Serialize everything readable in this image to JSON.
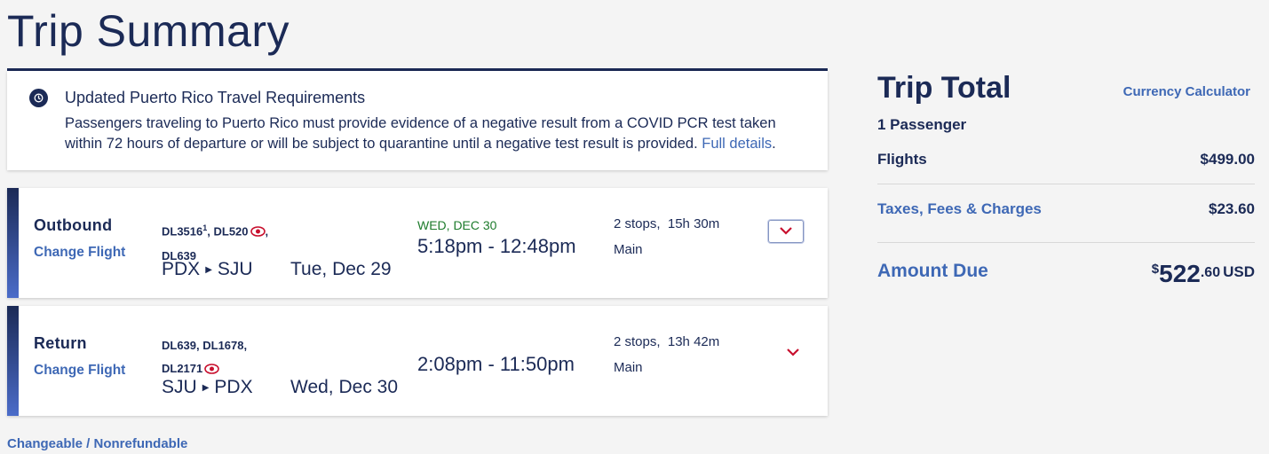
{
  "page": {
    "title": "Trip Summary"
  },
  "alert": {
    "title": "Updated Puerto Rico Travel Requirements",
    "body": "Passengers traveling to Puerto Rico must provide evidence of a negative result from a COVID PCR test taken within 72 hours of departure or will be subject to quarantine until a negative test result is provided.",
    "link_label": "Full details",
    "link_suffix": ".",
    "icon": "info-refresh-icon"
  },
  "flights": [
    {
      "direction": "Outbound",
      "change_label": "Change Flight",
      "flight_numbers_line1": "DL3516",
      "flight_numbers_sup": "1",
      "flight_numbers_line1b": ", DL520",
      "flight_numbers_line1_end": ",",
      "flight_numbers_line2": "DL639",
      "origin": "PDX",
      "destination": "SJU",
      "date": "Tue, Dec 29",
      "arrival_note": "WED, DEC 30",
      "times": "5:18pm - 12:48pm",
      "stops": "2 stops,",
      "duration": "15h 30m",
      "cabin": "Main"
    },
    {
      "direction": "Return",
      "change_label": "Change Flight",
      "flight_numbers_line1": "DL639, DL1678,",
      "flight_numbers_line2": "DL2171",
      "origin": "SJU",
      "destination": "PDX",
      "date": "Wed, Dec 30",
      "arrival_note": "",
      "times": "2:08pm - 11:50pm",
      "stops": "2 stops,",
      "duration": "13h 42m",
      "cabin": "Main"
    }
  ],
  "fare_note": "Changeable / Nonrefundable",
  "summary": {
    "title": "Trip Total",
    "currency_link": "Currency Calculator",
    "passengers": "1 Passenger",
    "flights_label": "Flights",
    "flights_value": "$499.00",
    "taxes_label": "Taxes, Fees & Charges",
    "taxes_value": "$23.60",
    "amount_label": "Amount Due",
    "amount_currency_symbol": "$",
    "amount_dollars": "522",
    "amount_cents": ".60",
    "amount_code": "USD"
  },
  "colors": {
    "navy": "#1b2a56",
    "link": "#3e68b5",
    "green": "#1d7b2c",
    "red": "#c8102e"
  }
}
